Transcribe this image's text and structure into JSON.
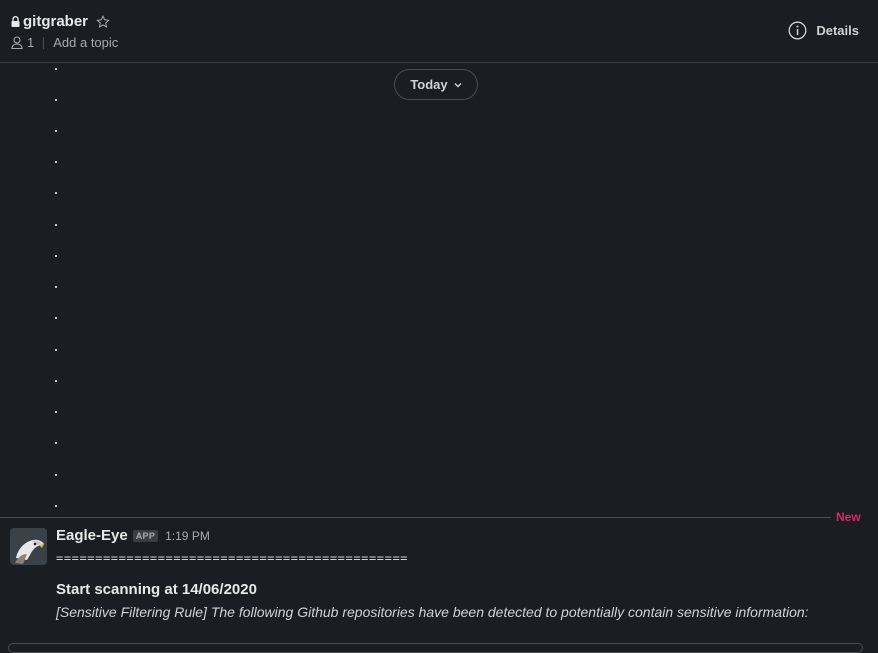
{
  "header": {
    "channel_name": "gitgraber",
    "member_count": "1",
    "topic_placeholder": "Add a topic",
    "details_label": "Details"
  },
  "timeline": {
    "date_pill": "Today"
  },
  "divider": {
    "new_label": "New"
  },
  "message": {
    "sender": "Eagle-Eye",
    "badge": "APP",
    "time": "1:19 PM",
    "separator": "=============================================",
    "line1": "Start scanning at 14/06/2020",
    "line2": "[Sensitive Filtering Rule] The following Github repositories have been detected to potentially contain sensitive information:"
  },
  "icons": {
    "lock": "lock-icon",
    "star": "star-icon",
    "member": "member-icon",
    "info": "info-icon",
    "chevron": "chevron-down-icon"
  },
  "colors": {
    "background": "#1a1d21",
    "new_divider": "#e0245e"
  }
}
